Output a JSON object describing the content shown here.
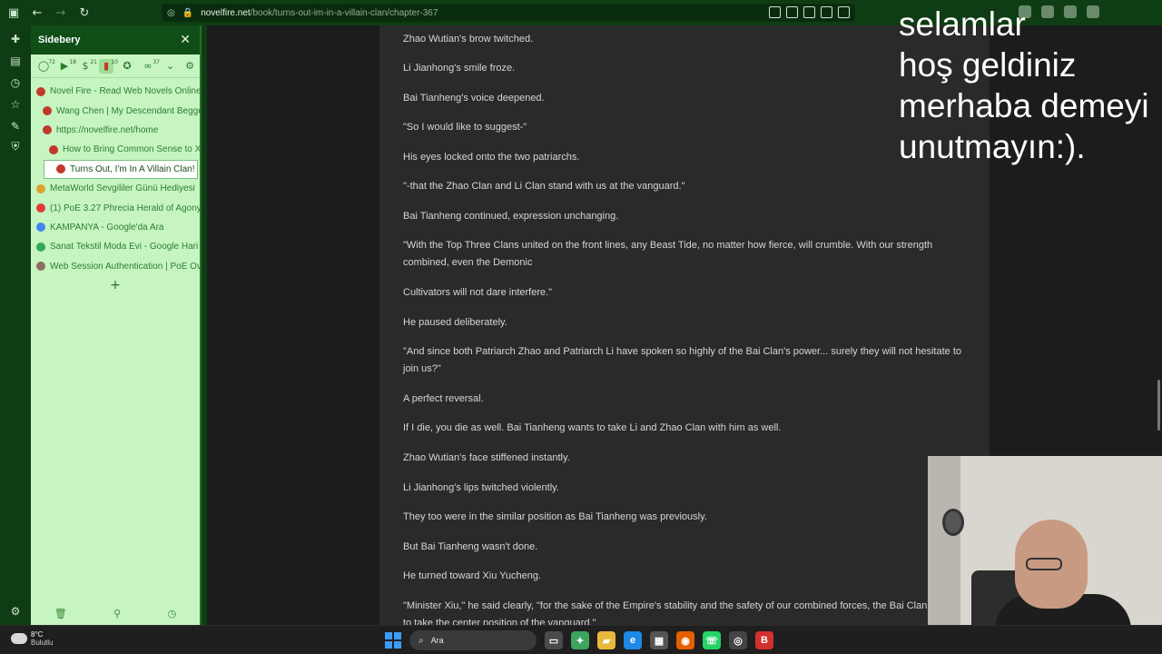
{
  "browser": {
    "url_prefix": "novelfire.net",
    "url_path": "/book/turns-out-im-in-a-villain-clan/chapter-367"
  },
  "sidebery": {
    "title": "Sidebery",
    "panels": [
      {
        "icon": "globe-icon",
        "count": "72"
      },
      {
        "icon": "play-icon",
        "count": "18"
      },
      {
        "icon": "dollar-icon",
        "count": "21"
      },
      {
        "icon": "book-icon",
        "count": "10"
      },
      {
        "icon": "gamepad-icon",
        "count": ""
      },
      {
        "icon": "glasses-icon",
        "count": "37"
      }
    ],
    "tabs": [
      {
        "label": "Novel Fire - Read Web Novels Online",
        "level": 0,
        "color": "#c0392b"
      },
      {
        "label": "Wang Chen | My Descendant Begge",
        "level": 1,
        "color": "#c0392b"
      },
      {
        "label": "https://novelfire.net/home",
        "level": 1,
        "color": "#c0392b"
      },
      {
        "label": "How to Bring Common Sense to X",
        "level": 2,
        "color": "#c0392b"
      },
      {
        "label": "Turns Out, I'm In A Villain Clan! - C",
        "level": 1,
        "color": "#c0392b",
        "active": true
      },
      {
        "label": "MetaWorld Sevgililer Günü Hediyesi",
        "level": 0,
        "color": "#e0a030"
      },
      {
        "label": "(1) PoE 3.27 Phrecia Herald of Agony",
        "level": 0,
        "color": "#e53935"
      },
      {
        "label": "KAMPANYA - Google'da Ara",
        "level": 0,
        "color": "#4285f4"
      },
      {
        "label": "Sanat Tekstil Moda Evi - Google Hari",
        "level": 0,
        "color": "#34a853"
      },
      {
        "label": "Web Session Authentication | PoE Ov",
        "level": 0,
        "color": "#8d6e63"
      }
    ],
    "add_tab": "+"
  },
  "article": {
    "paragraphs": [
      "Zhao Wutian's brow twitched.",
      "Li Jianhong's smile froze.",
      "Bai Tianheng's voice deepened.",
      "\"So I would like to suggest-\"",
      "His eyes locked onto the two patriarchs.",
      "\"-that the Zhao Clan and Li Clan stand with us at the vanguard.\"",
      "Bai Tianheng continued, expression unchanging.",
      "\"With the Top Three Clans united on the front lines, any Beast Tide, no matter how fierce, will crumble. With our strength combined, even the Demonic",
      "Cultivators will not dare interfere.\"",
      "He paused deliberately.",
      "\"And since both Patriarch Zhao and Patriarch Li have spoken so highly of the Bai Clan's power... surely they will not hesitate to join us?\"",
      "A perfect reversal.",
      "If I die, you die as well. Bai Tianheng wants to take Li and Zhao Clan with him as well.",
      "Zhao Wutian's face stiffened instantly.",
      "Li Jianhong's lips twitched violently.",
      "They too were in the similar position as Bai Tianheng was previously.",
      "But Bai Tianheng wasn't done.",
      "He turned toward Xiu Yucheng.",
      "\"Minister Xiu,\" he said clearly, \"for the sake of the Empire's stability and the safety of our combined forces, the Bai Clan is willing to take the center position of the vanguard.\""
    ]
  },
  "overlay": {
    "lines": [
      "selamlar",
      "hoş geldiniz",
      "merhaba demeyi",
      "unutmayın:)."
    ]
  },
  "taskbar": {
    "temperature": "8°C",
    "condition": "Bulutlu",
    "search_label": "Ara",
    "apps": [
      "file-explorer-icon",
      "edge-icon",
      "store-icon",
      "firefox-icon",
      "whatsapp-icon",
      "steam-icon",
      "brave-icon"
    ]
  }
}
